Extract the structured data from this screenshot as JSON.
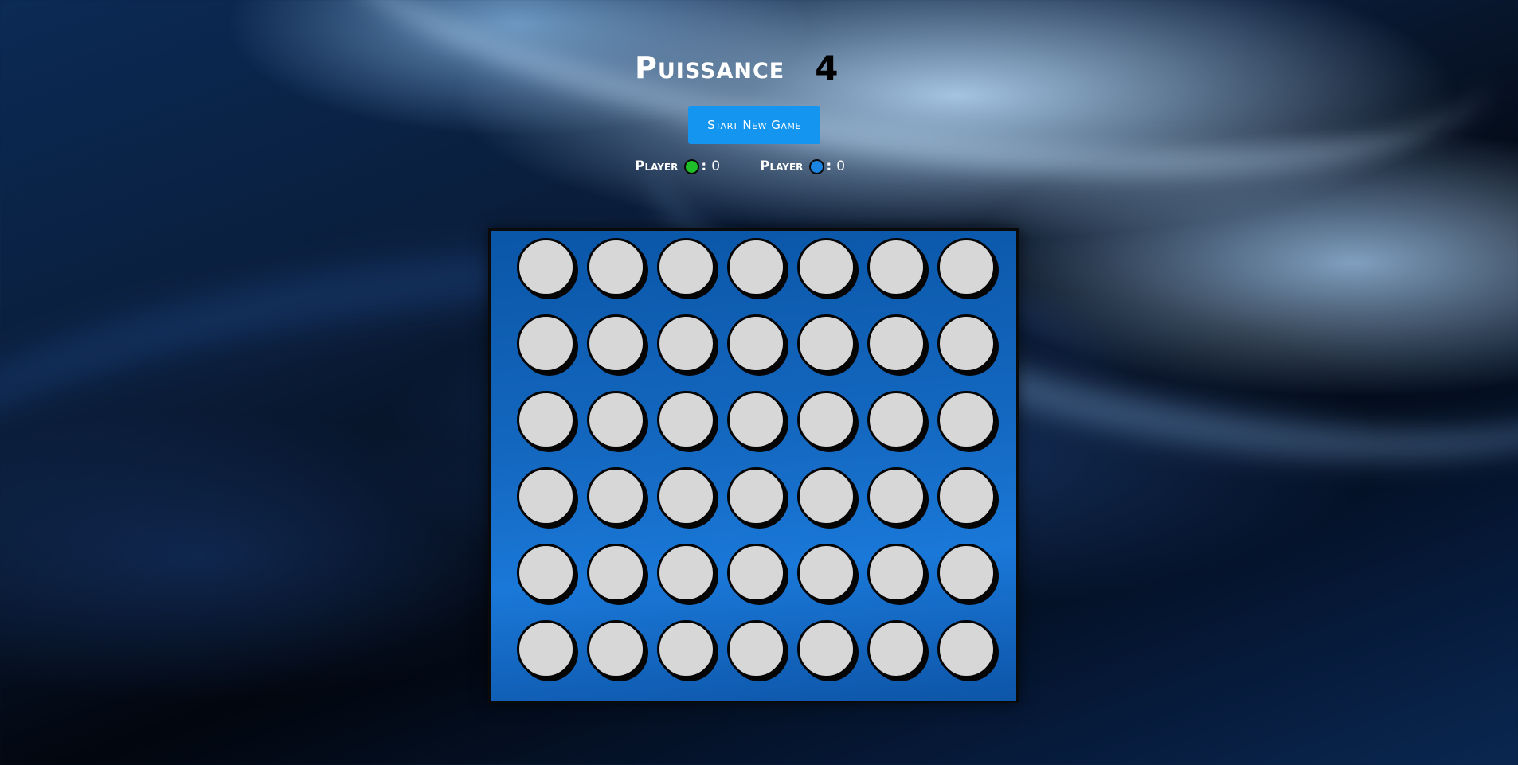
{
  "game": {
    "title_word": "Puissance",
    "title_number": "4",
    "start_button_label": "Start New Game"
  },
  "scores": [
    {
      "label": "Player",
      "color": "#1fbf2a",
      "color_name": "green",
      "separator": ":",
      "value": "0"
    },
    {
      "label": "Player",
      "color": "#1a84e0",
      "color_name": "blue",
      "separator": ":",
      "value": "0"
    }
  ],
  "board": {
    "rows": 6,
    "columns": 7,
    "empty_cell_color": "#d7d7d7",
    "board_color": "#1468c0",
    "cells": [
      [
        "empty",
        "empty",
        "empty",
        "empty",
        "empty",
        "empty",
        "empty"
      ],
      [
        "empty",
        "empty",
        "empty",
        "empty",
        "empty",
        "empty",
        "empty"
      ],
      [
        "empty",
        "empty",
        "empty",
        "empty",
        "empty",
        "empty",
        "empty"
      ],
      [
        "empty",
        "empty",
        "empty",
        "empty",
        "empty",
        "empty",
        "empty"
      ],
      [
        "empty",
        "empty",
        "empty",
        "empty",
        "empty",
        "empty",
        "empty"
      ],
      [
        "empty",
        "empty",
        "empty",
        "empty",
        "empty",
        "empty",
        "empty"
      ]
    ]
  }
}
